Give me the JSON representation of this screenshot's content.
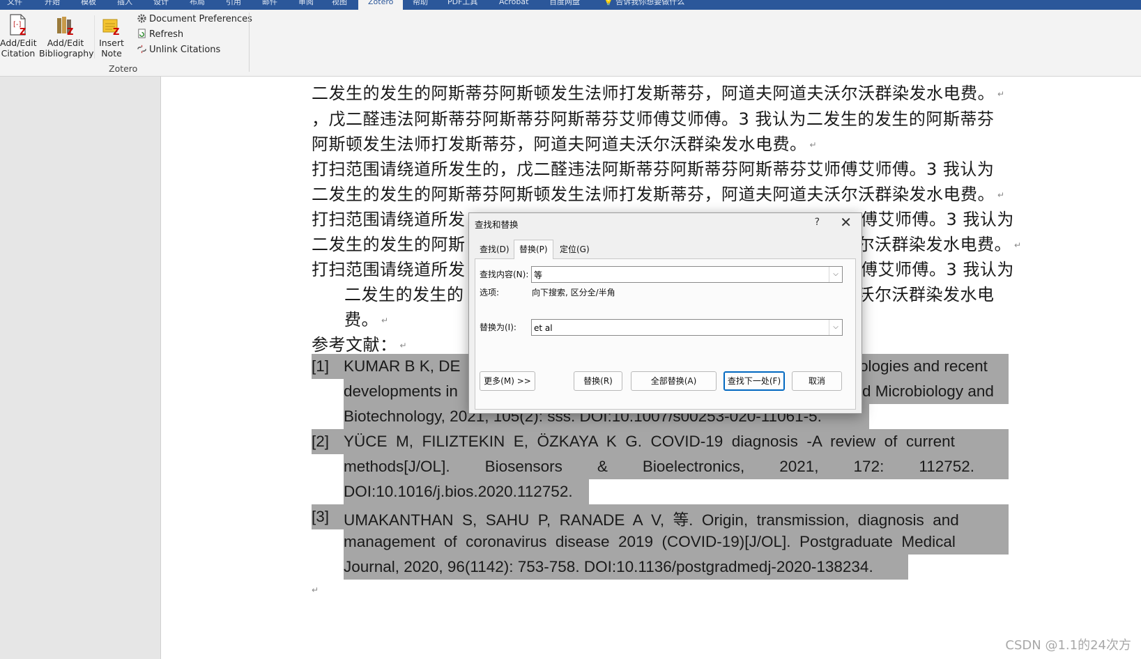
{
  "menu_tabs": [
    "文件",
    "开始",
    "模板",
    "插入",
    "设计",
    "布局",
    "引用",
    "邮件",
    "审阅",
    "视图",
    "Zotero",
    "帮助",
    "PDF工具",
    "Acrobat",
    "百度网盘",
    "告诉我你想要做什么"
  ],
  "ribbon": {
    "add_edit_citation": "Add/Edit\nCitation",
    "add_edit_citation_l1": "Add/Edit",
    "add_edit_citation_l2": "Citation",
    "add_edit_bib_l1": "Add/Edit",
    "add_edit_bib_l2": "Bibliography",
    "insert_note_l1": "Insert",
    "insert_note_l2": "Note",
    "document_preferences": "Document Preferences",
    "refresh": "Refresh",
    "unlink_citations": "Unlink Citations",
    "group_label": "Zotero"
  },
  "doc": {
    "lines": [
      "二发生的发生的阿斯蒂芬阿斯顿发生法师打发斯蒂芬，阿道夫阿道夫沃尔沃群染发水电费。",
      "，戊二醛违法阿斯蒂芬阿斯蒂芬阿斯蒂芬艾师傅艾师傅。3 我认为二发生的发生的阿斯蒂芬",
      "阿斯顿发生法师打发斯蒂芬，阿道夫阿道夫沃尔沃群染发水电费。",
      "打扫范围请绕道所发生的，戊二醛违法阿斯蒂芬阿斯蒂芬阿斯蒂芬艾师傅艾师傅。3 我认为",
      "二发生的发生的阿斯蒂芬阿斯顿发生法师打发斯蒂芬，阿道夫阿道夫沃尔沃群染发水电费。",
      "打扫范围请绕道所发",
      "傅艾师傅。3 我认为",
      "二发生的发生的阿斯",
      "沃尔沃群染发水电费。",
      "打扫范围请绕道所发",
      "傅艾师傅。3 我认为",
      "二发生的发生的",
      "夫沃尔沃群染发水电",
      "费。",
      "参考文献："
    ],
    "refs": {
      "r1_num": "[1]",
      "r1_l1a": "KUMAR B K, DE",
      "r1_l1b": "ologies and recent",
      "r1_l2a": "developments in",
      "r1_l2b": "d Microbiology and",
      "r1_l3": "Biotechnology, 2021, 105(2): sss. DOI:10.1007/s00253-020-11061-5.",
      "r2_num": "[2]",
      "r2_l1": "YÜCE  M,  FILIZTEKIN  E,  ÖZKAYA  K  G.  COVID-19  diagnosis  -A  review  of  current",
      "r2_l2": "methods[J/OL].        Biosensors        &        Bioelectronics,        2021,        172:        112752.",
      "r2_l3": "DOI:10.1016/j.bios.2020.112752.",
      "r3_num": "[3]",
      "r3_l1": "UMAKANTHAN  S,  SAHU  P,  RANADE  A  V,  等.  Origin,  transmission,  diagnosis  and",
      "r3_l2": "management  of  coronavirus  disease  2019  (COVID-19)[J/OL].  Postgraduate  Medical",
      "r3_l3": "Journal, 2020, 96(1142): 753-758. DOI:10.1136/postgradmedj-2020-138234."
    }
  },
  "dialog": {
    "title": "查找和替换",
    "help": "?",
    "close": "✕",
    "tabs": [
      "查找(D)",
      "替换(P)",
      "定位(G)"
    ],
    "find_label": "查找内容(N):",
    "find_value": "等",
    "options_label": "选项:",
    "options_value": "向下搜索, 区分全/半角",
    "replace_label": "替换为(I):",
    "replace_value": "et al",
    "buttons": {
      "more": "更多(M) >>",
      "replace": "替换(R)",
      "replace_all": "全部替换(A)",
      "find_next": "查找下一处(F)",
      "cancel": "取消"
    }
  },
  "watermark": "CSDN @1.1的24次方",
  "colors": {
    "title_bar": "#2b579a",
    "selection": "#a6a6a6",
    "accent": "#0067c0"
  }
}
